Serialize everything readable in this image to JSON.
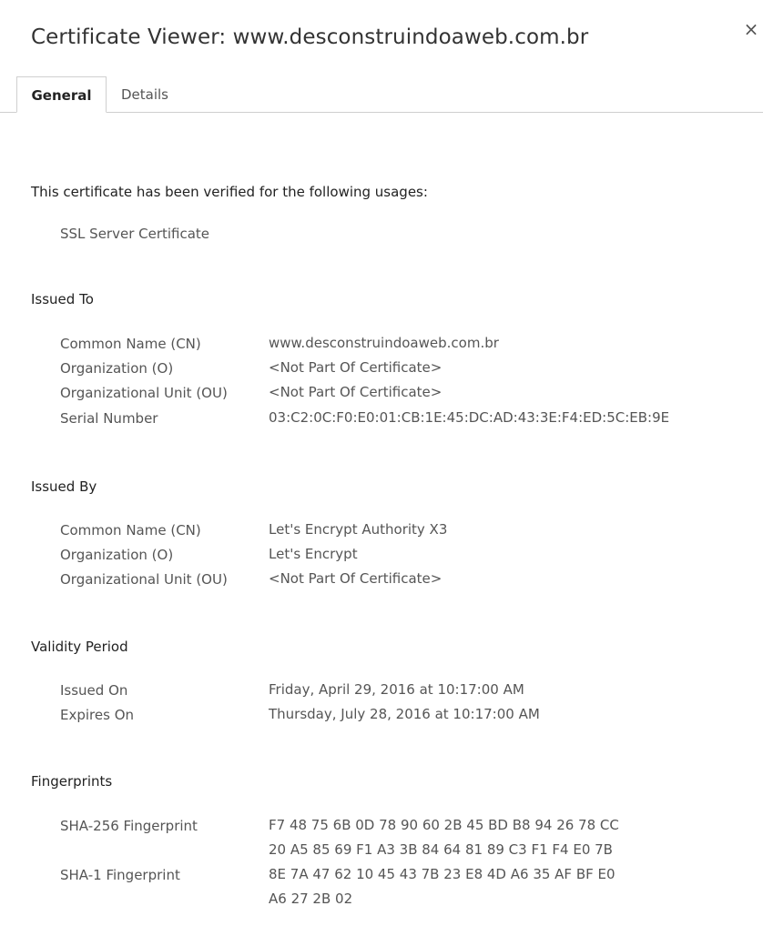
{
  "window": {
    "title": "Certificate Viewer: www.desconstruindoaweb.com.br",
    "close_glyph": "×"
  },
  "tabs": [
    {
      "label": "General",
      "selected": true
    },
    {
      "label": "Details",
      "selected": false
    }
  ],
  "usages": {
    "heading": "This certificate has been verified for the following usages:",
    "items": [
      "SSL Server Certificate"
    ]
  },
  "issued_to": {
    "title": "Issued To",
    "rows": [
      {
        "label": "Common Name (CN)",
        "value": "www.desconstruindoaweb.com.br"
      },
      {
        "label": "Organization (O)",
        "value": "<Not Part Of Certificate>"
      },
      {
        "label": "Organizational Unit (OU)",
        "value": "<Not Part Of Certificate>"
      },
      {
        "label": "Serial Number",
        "value": "03:C2:0C:F0:E0:01:CB:1E:45:DC:AD:43:3E:F4:ED:5C:EB:9E"
      }
    ]
  },
  "issued_by": {
    "title": "Issued By",
    "rows": [
      {
        "label": "Common Name (CN)",
        "value": "Let's Encrypt Authority X3"
      },
      {
        "label": "Organization (O)",
        "value": "Let's Encrypt"
      },
      {
        "label": "Organizational Unit (OU)",
        "value": "<Not Part Of Certificate>"
      }
    ]
  },
  "validity": {
    "title": "Validity Period",
    "rows": [
      {
        "label": "Issued On",
        "value": "Friday, April 29, 2016 at 10:17:00 AM"
      },
      {
        "label": "Expires On",
        "value": "Thursday, July 28, 2016 at 10:17:00 AM"
      }
    ]
  },
  "fingerprints": {
    "title": "Fingerprints",
    "rows": [
      {
        "label": "SHA-256 Fingerprint",
        "value_lines": [
          "F7 48 75 6B 0D 78 90 60 2B 45 BD B8 94 26 78 CC",
          "20 A5 85 69 F1 A3 3B 84 64 81 89 C3 F1 F4 E0 7B"
        ]
      },
      {
        "label": "SHA-1 Fingerprint",
        "value_lines": [
          "8E 7A 47 62 10 45 43 7B 23 E8 4D A6 35 AF BF E0",
          "A6 27 2B 02"
        ]
      }
    ]
  }
}
